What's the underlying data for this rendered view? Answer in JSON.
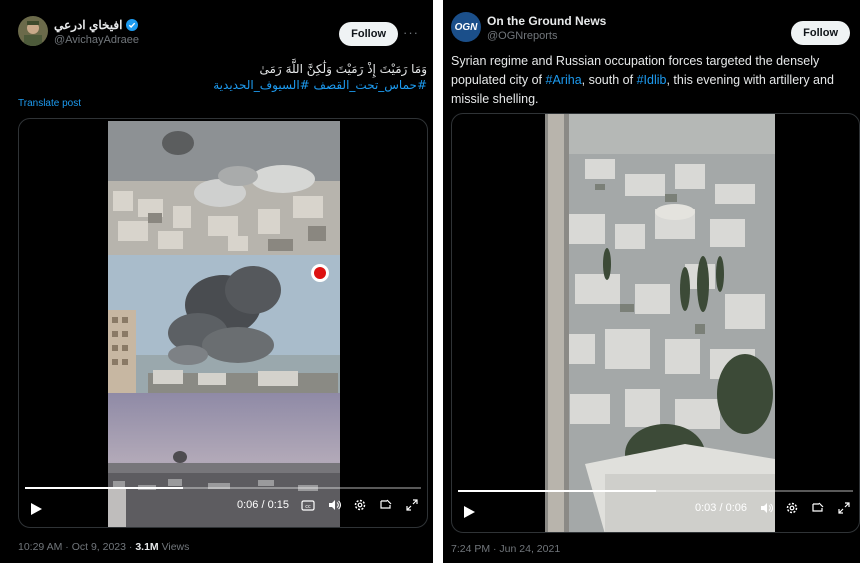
{
  "left_post": {
    "author_name": "افيخاي ادرعي",
    "handle": "@AvichayAdraee",
    "follow_label": "Follow",
    "more_label": "···",
    "text": "وَمَا رَمَيْتَ إِذْ رَمَيْتَ وَلَٰكِنَّ اللَّهَ رَمَىٰ",
    "hashtags": "#حماس_تحت_القصف #السيوف_الحديدية",
    "translate_label": "Translate post",
    "video": {
      "time": "0:06 / 0:15",
      "progress": 0.4
    },
    "footer_time": "10:29 AM · Oct 9, 2023 · ",
    "views_count": "3.1M",
    "views_label": " Views"
  },
  "right_post": {
    "author_name": "On the Ground News",
    "handle": "@OGNreports",
    "follow_label": "Follow",
    "avatar_text": "OGN",
    "text_1": "Syrian regime and Russian occupation forces targeted the densely populated city of ",
    "tag_1": "#Ariha",
    "text_2": ", south of ",
    "tag_2": "#Idlib",
    "text_3": ", this evening with artillery and missile shelling.",
    "video": {
      "time": "0:03 / 0:06",
      "progress": 0.5
    },
    "footer_time": "7:24 PM · Jun 24, 2021"
  },
  "colors": {
    "accent": "#1d9bf0",
    "background": "#000000",
    "muted": "#71767b"
  }
}
